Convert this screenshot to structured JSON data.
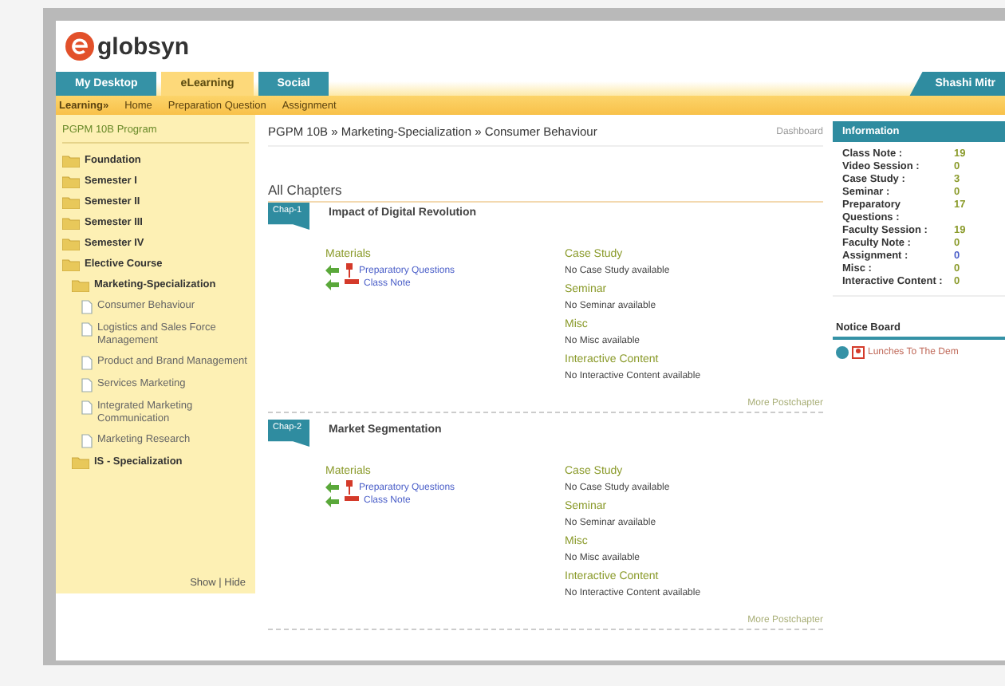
{
  "logo": {
    "text": "globsyn"
  },
  "nav": {
    "tabs": [
      {
        "label": "My Desktop",
        "selected": false
      },
      {
        "label": "eLearning",
        "selected": true
      },
      {
        "label": "Social",
        "selected": false
      }
    ],
    "user": "Shashi Mitr"
  },
  "subnav": {
    "lead": "Learning»",
    "links": [
      "Home",
      "Preparation Question",
      "Assignment"
    ]
  },
  "sidebar": {
    "title": "PGPM 10B Program",
    "toggle": "Show | Hide",
    "tree": [
      {
        "label": "Foundation",
        "kind": "folder"
      },
      {
        "label": "Semester I",
        "kind": "folder"
      },
      {
        "label": "Semester II",
        "kind": "folder"
      },
      {
        "label": "Semester III",
        "kind": "folder"
      },
      {
        "label": "Semester IV",
        "kind": "folder"
      },
      {
        "label": "Elective Course",
        "kind": "folder",
        "children": [
          {
            "label": "Marketing-Specialization",
            "kind": "folder",
            "children": [
              {
                "label": "Consumer Behaviour",
                "kind": "page"
              },
              {
                "label": "Logistics and Sales Force Management",
                "kind": "page"
              },
              {
                "label": "Product and Brand Management",
                "kind": "page"
              },
              {
                "label": "Services Marketing",
                "kind": "page"
              },
              {
                "label": "Integrated Marketing Communication",
                "kind": "page"
              },
              {
                "label": "Marketing Research",
                "kind": "page"
              }
            ]
          },
          {
            "label": "IS - Specialization",
            "kind": "folder"
          }
        ]
      }
    ]
  },
  "main": {
    "breadcrumb": "PGPM 10B » Marketing-Specialization » Consumer Behaviour",
    "side_link": "Dashboard",
    "heading": "All Chapters",
    "chapters": [
      {
        "badge": "Chap-1",
        "title": "Impact of Digital Revolution",
        "materials_heading": "Materials",
        "materials": [
          "Preparatory Questions",
          "Class Note"
        ],
        "sections": [
          {
            "heading": "Case Study",
            "text": "No Case Study available"
          },
          {
            "heading": "Seminar",
            "text": "No Seminar available"
          },
          {
            "heading": "Misc",
            "text": "No Misc available"
          },
          {
            "heading": "Interactive Content",
            "text": "No Interactive Content available"
          }
        ],
        "more": "More Postchapter"
      },
      {
        "badge": "Chap-2",
        "title": "Market Segmentation",
        "materials_heading": "Materials",
        "materials": [
          "Preparatory Questions",
          "Class Note"
        ],
        "sections": [
          {
            "heading": "Case Study",
            "text": "No Case Study available"
          },
          {
            "heading": "Seminar",
            "text": "No Seminar available"
          },
          {
            "heading": "Misc",
            "text": "No Misc available"
          },
          {
            "heading": "Interactive Content",
            "text": "No Interactive Content available"
          }
        ],
        "more": "More Postchapter"
      }
    ]
  },
  "info": {
    "title": "Information",
    "rows": [
      {
        "label": "Class Note :",
        "value": "19",
        "color": "#8a9a2a"
      },
      {
        "label": "Video Session :",
        "value": "0",
        "color": "#8a9a2a"
      },
      {
        "label": "Case Study :",
        "value": "3",
        "color": "#8a9a2a"
      },
      {
        "label": "Seminar :",
        "value": "0",
        "color": "#8a9a2a"
      },
      {
        "label": "Preparatory Questions :",
        "value": "17",
        "color": "#8a9a2a"
      },
      {
        "label": "Faculty Session :",
        "value": "19",
        "color": "#8a9a2a"
      },
      {
        "label": "Faculty Note :",
        "value": "0",
        "color": "#8a9a2a"
      },
      {
        "label": "Assignment :",
        "value": "0",
        "color": "#4a5ec8"
      },
      {
        "label": "Misc :",
        "value": "0",
        "color": "#8a9a2a"
      },
      {
        "label": "Interactive Content :",
        "value": "0",
        "color": "#8a9a2a"
      }
    ]
  },
  "notice": {
    "title": "Notice Board",
    "items": [
      "Lunches To The Dem"
    ]
  }
}
